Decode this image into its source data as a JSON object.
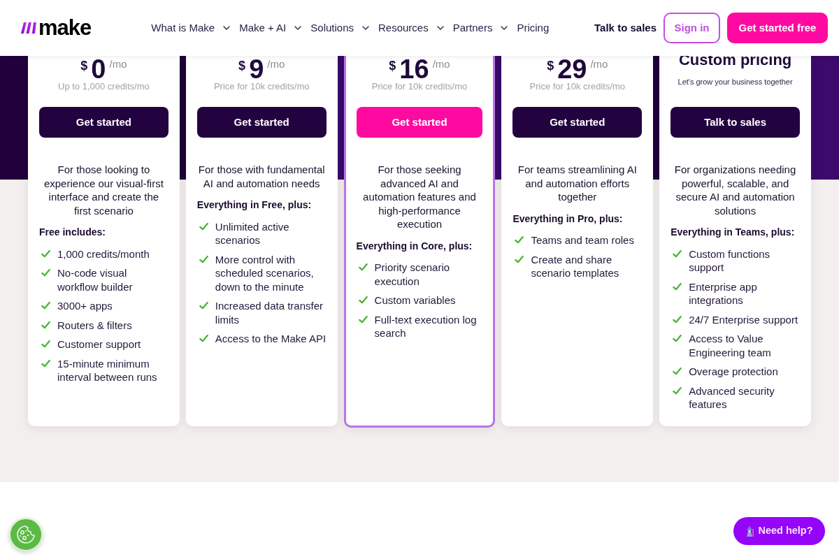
{
  "header": {
    "logo": "make",
    "nav": [
      {
        "label": "What is Make",
        "dropdown": true
      },
      {
        "label": "Make + AI",
        "dropdown": true
      },
      {
        "label": "Solutions",
        "dropdown": true
      },
      {
        "label": "Resources",
        "dropdown": true
      },
      {
        "label": "Partners",
        "dropdown": true
      },
      {
        "label": "Pricing",
        "dropdown": false
      }
    ],
    "talk_to_sales": "Talk to sales",
    "sign_in": "Sign in",
    "cta": "Get started free"
  },
  "plans": [
    {
      "kind": "priced",
      "highlighted": false,
      "currency": "$",
      "amount": "0",
      "period": "/mo",
      "note": "Up to 1,000 credits/mo",
      "button": "Get started",
      "description": "For those looking to experience our visual-first interface and create the first scenario",
      "features_heading": "Free includes:",
      "features": [
        "1,000 credits/month",
        "No-code visual workflow builder",
        "3000+ apps",
        "Routers & filters",
        "Customer support",
        "15-minute minimum interval between runs"
      ]
    },
    {
      "kind": "priced",
      "highlighted": false,
      "currency": "$",
      "amount": "9",
      "period": "/mo",
      "note": "Price for 10k credits/mo",
      "button": "Get started",
      "description": "For those with fundamental AI and automation needs",
      "features_heading": "Everything in Free, plus:",
      "features": [
        "Unlimited active scenarios",
        "More control with scheduled scenarios, down to the minute",
        "Increased data transfer limits",
        "Access to the Make API"
      ]
    },
    {
      "kind": "priced",
      "highlighted": true,
      "currency": "$",
      "amount": "16",
      "period": "/mo",
      "note": "Price for 10k credits/mo",
      "button": "Get started",
      "description": "For those seeking advanced AI and automation features and high-performance execution",
      "features_heading": "Everything in Core, plus:",
      "features": [
        "Priority scenario execution",
        "Custom variables",
        "Full-text execution log search"
      ]
    },
    {
      "kind": "priced",
      "highlighted": false,
      "currency": "$",
      "amount": "29",
      "period": "/mo",
      "note": "Price for 10k credits/mo",
      "button": "Get started",
      "description": "For teams streamlining AI and automation efforts together",
      "features_heading": "Everything in Pro, plus:",
      "features": [
        "Teams and team roles",
        "Create and share scenario templates"
      ]
    },
    {
      "kind": "custom",
      "highlighted": false,
      "title": "Custom pricing",
      "note": "Let's grow your business together",
      "button": "Talk to sales",
      "description": "For organizations needing powerful, scalable, and secure AI and automation solutions",
      "features_heading": "Everything in Teams, plus:",
      "features": [
        "Custom functions support",
        "Enterprise app integrations",
        "24/7 Enterprise support",
        "Access to Value Engineering team",
        "Overage protection",
        "Advanced security features"
      ]
    }
  ],
  "help_button": {
    "label": "Need help?"
  }
}
